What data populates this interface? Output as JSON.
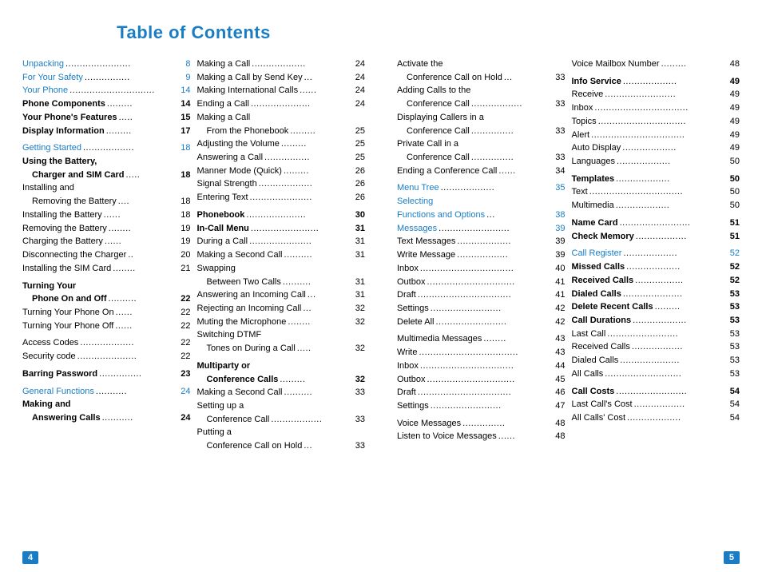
{
  "title": "Table of Contents",
  "left_page_num": "4",
  "right_page_num": "5",
  "left_col1": [
    {
      "label": "Unpacking",
      "dots": ".......................",
      "page": "8",
      "blue": true,
      "bold": false,
      "indent": 0
    },
    {
      "label": "For Your Safety",
      "dots": "................",
      "page": "9",
      "blue": true,
      "bold": false,
      "indent": 0
    },
    {
      "label": "Your Phone",
      "dots": "..............................",
      "page": "14",
      "blue": true,
      "bold": false,
      "indent": 0
    },
    {
      "label": "Phone Components",
      "dots": ".........",
      "page": "14",
      "blue": false,
      "bold": true,
      "indent": 0
    },
    {
      "label": "Your Phone's Features",
      "dots": ".....",
      "page": "15",
      "blue": false,
      "bold": true,
      "indent": 0
    },
    {
      "label": "Display Information",
      "dots": ".........",
      "page": "17",
      "blue": false,
      "bold": true,
      "indent": 0
    },
    {
      "label": "",
      "spacer": true
    },
    {
      "label": "Getting Started",
      "dots": "..................",
      "page": "18",
      "blue": true,
      "bold": false,
      "indent": 0
    },
    {
      "label": "Using the Battery,",
      "dots": "",
      "page": "",
      "blue": false,
      "bold": true,
      "indent": 0
    },
    {
      "label": "Charger and SIM Card",
      "dots": ".....",
      "page": "18",
      "blue": false,
      "bold": true,
      "indent": 1
    },
    {
      "label": "Installing and",
      "dots": "",
      "page": "",
      "blue": false,
      "bold": false,
      "indent": 0
    },
    {
      "label": "Removing the Battery",
      "dots": "....",
      "page": "18",
      "blue": false,
      "bold": false,
      "indent": 1
    },
    {
      "label": "Installing the Battery",
      "dots": "......",
      "page": "18",
      "blue": false,
      "bold": false,
      "indent": 0
    },
    {
      "label": "Removing the Battery",
      "dots": "........",
      "page": "19",
      "blue": false,
      "bold": false,
      "indent": 0
    },
    {
      "label": "Charging the Battery",
      "dots": "......",
      "page": "19",
      "blue": false,
      "bold": false,
      "indent": 0
    },
    {
      "label": "Disconnecting the Charger",
      "dots": "..",
      "page": "20",
      "blue": false,
      "bold": false,
      "indent": 0
    },
    {
      "label": "Installing the SIM Card",
      "dots": "........",
      "page": "21",
      "blue": false,
      "bold": false,
      "indent": 0
    },
    {
      "label": "",
      "spacer": true
    },
    {
      "label": "Turning Your",
      "dots": "",
      "page": "",
      "blue": false,
      "bold": true,
      "indent": 0
    },
    {
      "label": "Phone On and Off",
      "dots": "..........",
      "page": "22",
      "blue": false,
      "bold": true,
      "indent": 1
    },
    {
      "label": "Turning Your Phone On",
      "dots": "......",
      "page": "22",
      "blue": false,
      "bold": false,
      "indent": 0
    },
    {
      "label": "Turning Your Phone Off",
      "dots": "......",
      "page": "22",
      "blue": false,
      "bold": false,
      "indent": 0
    },
    {
      "label": "",
      "spacer": true
    },
    {
      "label": "Access Codes",
      "dots": "...................",
      "page": "22",
      "blue": false,
      "bold": false,
      "indent": 0
    },
    {
      "label": "Security code",
      "dots": ".....................",
      "page": "22",
      "blue": false,
      "bold": false,
      "indent": 0
    },
    {
      "label": "",
      "spacer": true
    },
    {
      "label": "Barring Password",
      "dots": "...............",
      "page": "23",
      "blue": false,
      "bold": true,
      "indent": 0
    },
    {
      "label": "",
      "spacer": true
    },
    {
      "label": "General Functions",
      "dots": "...........",
      "page": "24",
      "blue": true,
      "bold": false,
      "indent": 0
    },
    {
      "label": "Making and",
      "dots": "",
      "page": "",
      "blue": false,
      "bold": true,
      "indent": 0
    },
    {
      "label": "Answering Calls",
      "dots": "...........",
      "page": "24",
      "blue": false,
      "bold": true,
      "indent": 1
    }
  ],
  "left_col2": [
    {
      "label": "Making a Call",
      "dots": "...................",
      "page": "24",
      "blue": false,
      "bold": false,
      "indent": 0
    },
    {
      "label": "Making a Call by Send Key",
      "dots": "...",
      "page": "24",
      "blue": false,
      "bold": false,
      "indent": 0
    },
    {
      "label": "Making International Calls",
      "dots": "......",
      "page": "24",
      "blue": false,
      "bold": false,
      "indent": 0
    },
    {
      "label": "Ending a Call",
      "dots": ".....................",
      "page": "24",
      "blue": false,
      "bold": false,
      "indent": 0
    },
    {
      "label": "Making a Call",
      "dots": "",
      "page": "",
      "blue": false,
      "bold": false,
      "indent": 0
    },
    {
      "label": "From the Phonebook",
      "dots": ".........",
      "page": "25",
      "blue": false,
      "bold": false,
      "indent": 1
    },
    {
      "label": "Adjusting the Volume",
      "dots": ".........",
      "page": "25",
      "blue": false,
      "bold": false,
      "indent": 0
    },
    {
      "label": "Answering a Call",
      "dots": "................",
      "page": "25",
      "blue": false,
      "bold": false,
      "indent": 0
    },
    {
      "label": "Manner Mode (Quick)",
      "dots": ".........",
      "page": "26",
      "blue": false,
      "bold": false,
      "indent": 0
    },
    {
      "label": "Signal Strength",
      "dots": "...................",
      "page": "26",
      "blue": false,
      "bold": false,
      "indent": 0
    },
    {
      "label": "Entering Text",
      "dots": "......................",
      "page": "26",
      "blue": false,
      "bold": false,
      "indent": 0
    },
    {
      "label": "",
      "spacer": true
    },
    {
      "label": "Phonebook",
      "dots": ".....................",
      "page": "30",
      "blue": false,
      "bold": true,
      "indent": 0
    },
    {
      "label": "In-Call Menu",
      "dots": "........................",
      "page": "31",
      "blue": false,
      "bold": true,
      "indent": 0
    },
    {
      "label": "During a Call",
      "dots": "......................",
      "page": "31",
      "blue": false,
      "bold": false,
      "indent": 0
    },
    {
      "label": "Making a Second Call",
      "dots": "..........",
      "page": "31",
      "blue": false,
      "bold": false,
      "indent": 0
    },
    {
      "label": "Swapping",
      "dots": "",
      "page": "",
      "blue": false,
      "bold": false,
      "indent": 0
    },
    {
      "label": "Between Two Calls",
      "dots": "..........",
      "page": "31",
      "blue": false,
      "bold": false,
      "indent": 1
    },
    {
      "label": "Answering an Incoming Call",
      "dots": "...",
      "page": "31",
      "blue": false,
      "bold": false,
      "indent": 0
    },
    {
      "label": "Rejecting an Incoming Call",
      "dots": "...",
      "page": "32",
      "blue": false,
      "bold": false,
      "indent": 0
    },
    {
      "label": "Muting the Microphone",
      "dots": "........",
      "page": "32",
      "blue": false,
      "bold": false,
      "indent": 0
    },
    {
      "label": "Switching DTMF",
      "dots": "",
      "page": "",
      "blue": false,
      "bold": false,
      "indent": 0
    },
    {
      "label": "Tones on During a Call",
      "dots": ".....",
      "page": "32",
      "blue": false,
      "bold": false,
      "indent": 1
    },
    {
      "label": "",
      "spacer": true
    },
    {
      "label": "Multiparty or",
      "dots": "",
      "page": "",
      "blue": false,
      "bold": true,
      "indent": 0
    },
    {
      "label": "Conference Calls",
      "dots": ".........",
      "page": "32",
      "blue": false,
      "bold": true,
      "indent": 1
    },
    {
      "label": "Making a Second Call",
      "dots": "..........",
      "page": "33",
      "blue": false,
      "bold": false,
      "indent": 0
    },
    {
      "label": "Setting up a",
      "dots": "",
      "page": "",
      "blue": false,
      "bold": false,
      "indent": 0
    },
    {
      "label": "Conference Call",
      "dots": "..................",
      "page": "33",
      "blue": false,
      "bold": false,
      "indent": 1
    },
    {
      "label": "Putting a",
      "dots": "",
      "page": "",
      "blue": false,
      "bold": false,
      "indent": 0
    },
    {
      "label": "Conference Call on Hold",
      "dots": "...",
      "page": "33",
      "blue": false,
      "bold": false,
      "indent": 1
    }
  ],
  "right_col1": [
    {
      "label": "Activate the",
      "dots": "",
      "page": "",
      "blue": false,
      "bold": false,
      "indent": 0
    },
    {
      "label": "Conference Call on Hold",
      "dots": "...",
      "page": "33",
      "blue": false,
      "bold": false,
      "indent": 1
    },
    {
      "label": "Adding Calls to the",
      "dots": "",
      "page": "",
      "blue": false,
      "bold": false,
      "indent": 0
    },
    {
      "label": "Conference Call",
      "dots": "..................",
      "page": "33",
      "blue": false,
      "bold": false,
      "indent": 1
    },
    {
      "label": "Displaying Callers in a",
      "dots": "",
      "page": "",
      "blue": false,
      "bold": false,
      "indent": 0
    },
    {
      "label": "Conference Call",
      "dots": "...............",
      "page": "33",
      "blue": false,
      "bold": false,
      "indent": 1
    },
    {
      "label": "Private Call in a",
      "dots": "",
      "page": "",
      "blue": false,
      "bold": false,
      "indent": 0
    },
    {
      "label": "Conference Call",
      "dots": "...............",
      "page": "33",
      "blue": false,
      "bold": false,
      "indent": 1
    },
    {
      "label": "Ending a Conference Call",
      "dots": "......",
      "page": "34",
      "blue": false,
      "bold": false,
      "indent": 0
    },
    {
      "label": "",
      "spacer": true
    },
    {
      "label": "Menu Tree",
      "dots": "...................",
      "page": "35",
      "blue": true,
      "bold": false,
      "indent": 0
    },
    {
      "label": "Selecting",
      "dots": "",
      "page": "",
      "blue": true,
      "bold": false,
      "indent": 0
    },
    {
      "label": "Functions and Options",
      "dots": "...",
      "page": "38",
      "blue": true,
      "bold": false,
      "indent": 0
    },
    {
      "label": "Messages",
      "dots": ".........................",
      "page": "39",
      "blue": true,
      "bold": false,
      "indent": 0
    },
    {
      "label": "Text Messages",
      "dots": "...................",
      "page": "39",
      "blue": false,
      "bold": false,
      "indent": 0
    },
    {
      "label": "Write Message",
      "dots": "..................",
      "page": "39",
      "blue": false,
      "bold": false,
      "indent": 0
    },
    {
      "label": "Inbox",
      "dots": ".................................",
      "page": "40",
      "blue": false,
      "bold": false,
      "indent": 0
    },
    {
      "label": "Outbox",
      "dots": "...............................",
      "page": "41",
      "blue": false,
      "bold": false,
      "indent": 0
    },
    {
      "label": "Draft",
      "dots": ".................................",
      "page": "41",
      "blue": false,
      "bold": false,
      "indent": 0
    },
    {
      "label": "Settings",
      "dots": ".........................",
      "page": "42",
      "blue": false,
      "bold": false,
      "indent": 0
    },
    {
      "label": "Delete All",
      "dots": ".........................",
      "page": "42",
      "blue": false,
      "bold": false,
      "indent": 0
    },
    {
      "label": "",
      "spacer": true
    },
    {
      "label": "Multimedia Messages",
      "dots": "........",
      "page": "43",
      "blue": false,
      "bold": false,
      "indent": 0
    },
    {
      "label": "Write",
      "dots": "...................................",
      "page": "43",
      "blue": false,
      "bold": false,
      "indent": 0
    },
    {
      "label": "Inbox",
      "dots": ".................................",
      "page": "44",
      "blue": false,
      "bold": false,
      "indent": 0
    },
    {
      "label": "Outbox",
      "dots": "...............................",
      "page": "45",
      "blue": false,
      "bold": false,
      "indent": 0
    },
    {
      "label": "Draft",
      "dots": ".................................",
      "page": "46",
      "blue": false,
      "bold": false,
      "indent": 0
    },
    {
      "label": "Settings",
      "dots": ".........................",
      "page": "47",
      "blue": false,
      "bold": false,
      "indent": 0
    },
    {
      "label": "",
      "spacer": true
    },
    {
      "label": "Voice Messages",
      "dots": "...............",
      "page": "48",
      "blue": false,
      "bold": false,
      "indent": 0
    },
    {
      "label": "Listen to Voice Messages",
      "dots": "......",
      "page": "48",
      "blue": false,
      "bold": false,
      "indent": 0
    }
  ],
  "right_col2": [
    {
      "label": "Voice Mailbox Number",
      "dots": ".........",
      "page": "48",
      "blue": false,
      "bold": false,
      "indent": 0
    },
    {
      "label": "",
      "spacer": true
    },
    {
      "label": "Info Service",
      "dots": "...................",
      "page": "49",
      "blue": false,
      "bold": true,
      "indent": 0
    },
    {
      "label": "Receive",
      "dots": ".........................",
      "page": "49",
      "blue": false,
      "bold": false,
      "indent": 0
    },
    {
      "label": "Inbox",
      "dots": ".................................",
      "page": "49",
      "blue": false,
      "bold": false,
      "indent": 0
    },
    {
      "label": "Topics",
      "dots": "...............................",
      "page": "49",
      "blue": false,
      "bold": false,
      "indent": 0
    },
    {
      "label": "Alert",
      "dots": ".................................",
      "page": "49",
      "blue": false,
      "bold": false,
      "indent": 0
    },
    {
      "label": "Auto Display",
      "dots": "...................",
      "page": "49",
      "blue": false,
      "bold": false,
      "indent": 0
    },
    {
      "label": "Languages",
      "dots": "...................",
      "page": "50",
      "blue": false,
      "bold": false,
      "indent": 0
    },
    {
      "label": "",
      "spacer": true
    },
    {
      "label": "Templates",
      "dots": "...................",
      "page": "50",
      "blue": false,
      "bold": true,
      "indent": 0
    },
    {
      "label": "Text",
      "dots": ".................................",
      "page": "50",
      "blue": false,
      "bold": false,
      "indent": 0
    },
    {
      "label": "Multimedia",
      "dots": "...................",
      "page": "50",
      "blue": false,
      "bold": false,
      "indent": 0
    },
    {
      "label": "",
      "spacer": true
    },
    {
      "label": "Name Card",
      "dots": ".........................",
      "page": "51",
      "blue": false,
      "bold": true,
      "indent": 0
    },
    {
      "label": "Check Memory",
      "dots": "..................",
      "page": "51",
      "blue": false,
      "bold": true,
      "indent": 0
    },
    {
      "label": "",
      "spacer": true
    },
    {
      "label": "Call Register",
      "dots": "...................",
      "page": "52",
      "blue": true,
      "bold": false,
      "indent": 0
    },
    {
      "label": "Missed Calls",
      "dots": "...................",
      "page": "52",
      "blue": false,
      "bold": true,
      "indent": 0
    },
    {
      "label": "Received Calls",
      "dots": ".................",
      "page": "52",
      "blue": false,
      "bold": true,
      "indent": 0
    },
    {
      "label": "Dialed Calls",
      "dots": ".....................",
      "page": "53",
      "blue": false,
      "bold": true,
      "indent": 0
    },
    {
      "label": "Delete Recent Calls",
      "dots": ".........",
      "page": "53",
      "blue": false,
      "bold": true,
      "indent": 0
    },
    {
      "label": "Call Durations",
      "dots": "...................",
      "page": "53",
      "blue": false,
      "bold": true,
      "indent": 0
    },
    {
      "label": "Last Call",
      "dots": ".........................",
      "page": "53",
      "blue": false,
      "bold": false,
      "indent": 0
    },
    {
      "label": "Received Calls",
      "dots": "..................",
      "page": "53",
      "blue": false,
      "bold": false,
      "indent": 0
    },
    {
      "label": "Dialed Calls",
      "dots": ".....................",
      "page": "53",
      "blue": false,
      "bold": false,
      "indent": 0
    },
    {
      "label": "All Calls",
      "dots": "...........................",
      "page": "53",
      "blue": false,
      "bold": false,
      "indent": 0
    },
    {
      "label": "",
      "spacer": true
    },
    {
      "label": "Call Costs",
      "dots": ".........................",
      "page": "54",
      "blue": false,
      "bold": true,
      "indent": 0
    },
    {
      "label": "Last Call's Cost",
      "dots": "..................",
      "page": "54",
      "blue": false,
      "bold": false,
      "indent": 0
    },
    {
      "label": "All Calls' Cost",
      "dots": "...................",
      "page": "54",
      "blue": false,
      "bold": false,
      "indent": 0
    }
  ]
}
